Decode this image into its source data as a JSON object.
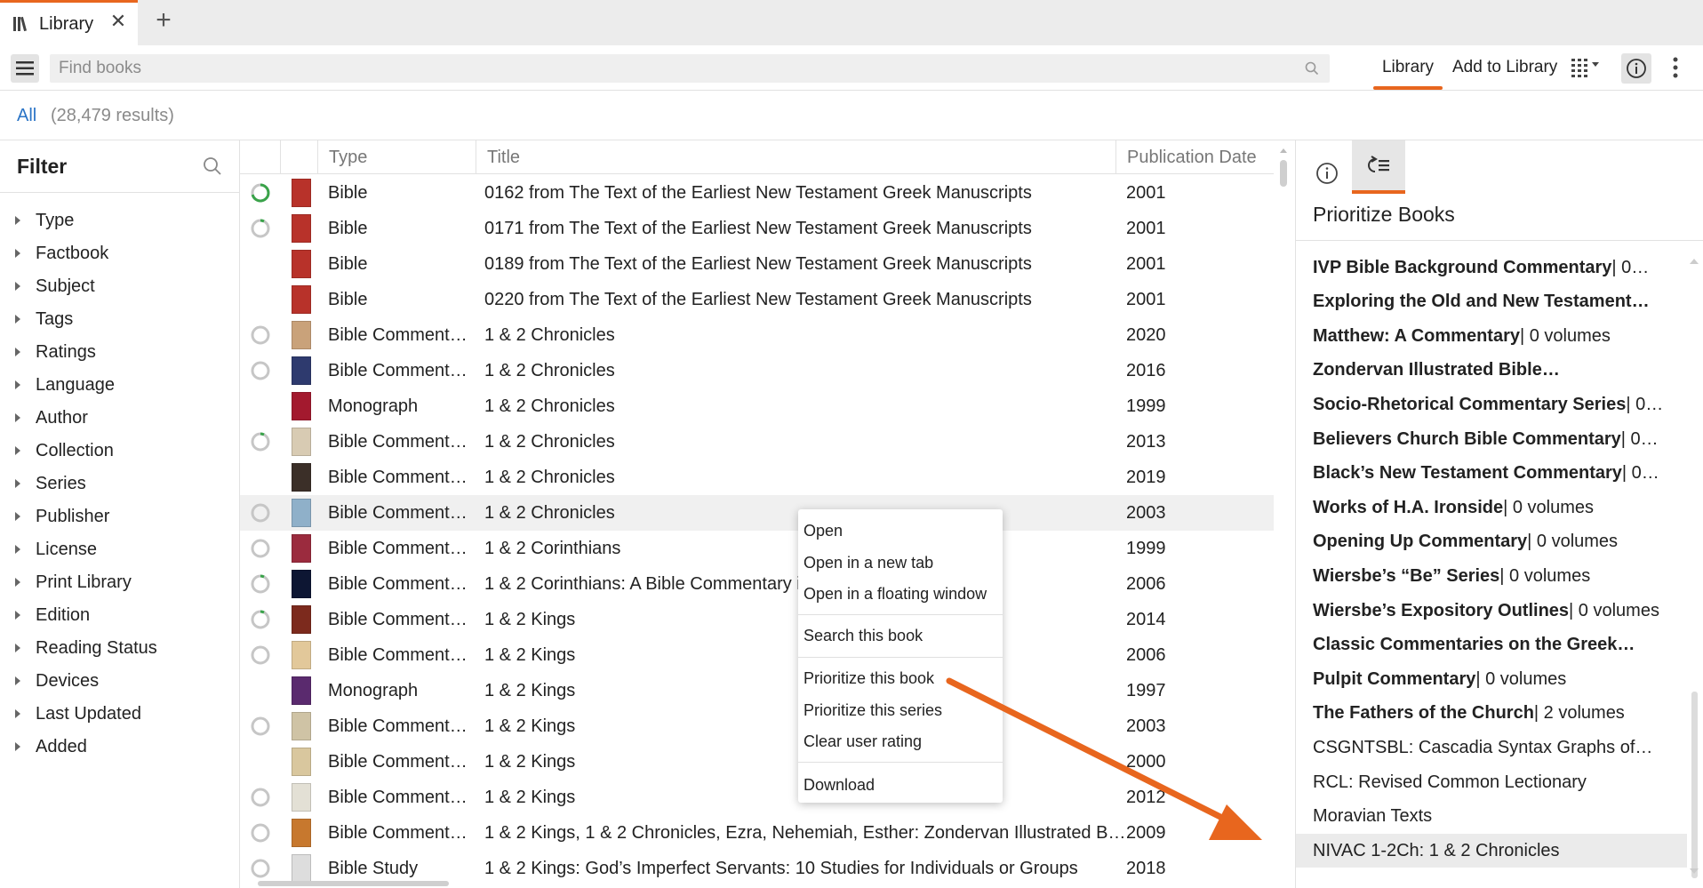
{
  "tab": {
    "label": "Library",
    "close_glyph": "✕",
    "add_glyph": "+"
  },
  "toolbar": {
    "search_placeholder": "Find books",
    "library_label": "Library",
    "add_to_library_label": "Add to Library"
  },
  "results": {
    "filter_label": "All",
    "count_text": "(28,479 results)"
  },
  "filter": {
    "title": "Filter",
    "items": [
      "Type",
      "Factbook",
      "Subject",
      "Tags",
      "Ratings",
      "Language",
      "Author",
      "Collection",
      "Series",
      "Publisher",
      "License",
      "Print Library",
      "Edition",
      "Reading Status",
      "Devices",
      "Last Updated",
      "Added"
    ]
  },
  "table": {
    "headers": {
      "type": "Type",
      "title": "Title",
      "date": "Publication Date"
    },
    "rows": [
      {
        "status": "progress-high",
        "cover": "#b8322a",
        "type": "Bible",
        "title": "0162 from The Text of the Earliest New Testament Greek Manuscripts",
        "date": "2001"
      },
      {
        "status": "progress-low",
        "cover": "#b8322a",
        "type": "Bible",
        "title": "0171 from The Text of the Earliest New Testament Greek Manuscripts",
        "date": "2001"
      },
      {
        "status": "none",
        "cover": "#b8322a",
        "type": "Bible",
        "title": "0189 from The Text of the Earliest New Testament Greek Manuscripts",
        "date": "2001"
      },
      {
        "status": "none",
        "cover": "#b8322a",
        "type": "Bible",
        "title": "0220 from The Text of the Earliest New Testament Greek Manuscripts",
        "date": "2001"
      },
      {
        "status": "empty",
        "cover": "#c9a27a",
        "type": "Bible Comment…",
        "title": "1 & 2 Chronicles",
        "date": "2020"
      },
      {
        "status": "empty",
        "cover": "#2e3a6e",
        "type": "Bible Comment…",
        "title": "1 & 2 Chronicles",
        "date": "2016"
      },
      {
        "status": "none",
        "cover": "#a3192e",
        "type": "Monograph",
        "title": "1 & 2 Chronicles",
        "date": "1999"
      },
      {
        "status": "progress-low",
        "cover": "#d8cbb3",
        "type": "Bible Comment…",
        "title": "1 & 2 Chronicles",
        "date": "2013"
      },
      {
        "status": "none",
        "cover": "#3b2f28",
        "type": "Bible Comment…",
        "title": "1 & 2 Chronicles",
        "date": "2019"
      },
      {
        "status": "empty",
        "cover": "#8fb0c9",
        "type": "Bible Comment…",
        "title": "1 & 2 Chronicles",
        "date": "2003"
      },
      {
        "status": "empty",
        "cover": "#9b2b3e",
        "type": "Bible Comment…",
        "title": "1 & 2 Corinthians",
        "date": "1999"
      },
      {
        "status": "progress-low",
        "cover": "#0d1633",
        "type": "Bible Comment…",
        "title": "1 & 2 Corinthians: A Bible Commentary i",
        "date": "2006"
      },
      {
        "status": "progress-low",
        "cover": "#7c2a1d",
        "type": "Bible Comment…",
        "title": "1 & 2 Kings",
        "date": "2014"
      },
      {
        "status": "empty",
        "cover": "#e2c89a",
        "type": "Bible Comment…",
        "title": "1 & 2 Kings",
        "date": "2006"
      },
      {
        "status": "none",
        "cover": "#5a2a6e",
        "type": "Monograph",
        "title": "1 & 2 Kings",
        "date": "1997"
      },
      {
        "status": "empty",
        "cover": "#cfc3a5",
        "type": "Bible Comment…",
        "title": "1 & 2 Kings",
        "date": "2003"
      },
      {
        "status": "none",
        "cover": "#d9c79e",
        "type": "Bible Comment…",
        "title": "1 & 2 Kings",
        "date": "2000"
      },
      {
        "status": "empty",
        "cover": "#e3e0d5",
        "type": "Bible Comment…",
        "title": "1 & 2 Kings",
        "date": "2012"
      },
      {
        "status": "empty",
        "cover": "#c7782e",
        "type": "Bible Comment…",
        "title": "1 & 2 Kings, 1 & 2 Chronicles, Ezra, Nehemiah, Esther: Zondervan Illustrated B…",
        "date": "2009"
      },
      {
        "status": "empty",
        "cover": "#dddddd",
        "type": "Bible Study",
        "title": "1 & 2 Kings: God’s Imperfect Servants: 10 Studies for Individuals or Groups",
        "date": "2018"
      }
    ]
  },
  "context_menu": {
    "items": [
      "Open",
      "Open in a new tab",
      "Open in a floating window",
      "Search this book",
      "Prioritize this book",
      "Prioritize this series",
      "Clear user rating",
      "Download"
    ]
  },
  "right_panel": {
    "title": "Prioritize Books",
    "items": [
      {
        "name": "IVP Bible Background Commentary",
        "suffix": " | 0…",
        "bold": true
      },
      {
        "name": "Exploring the Old and New Testament…",
        "suffix": "",
        "bold": true
      },
      {
        "name": "Matthew: A Commentary",
        "suffix": " | 0 volumes",
        "bold": true
      },
      {
        "name": "Zondervan Illustrated Bible…",
        "suffix": "",
        "bold": true
      },
      {
        "name": "Socio-Rhetorical Commentary Series",
        "suffix": " | 0…",
        "bold": true
      },
      {
        "name": "Believers Church Bible Commentary",
        "suffix": " | 0…",
        "bold": true
      },
      {
        "name": "Black’s New Testament Commentary",
        "suffix": " | 0…",
        "bold": true
      },
      {
        "name": "Works of H.A. Ironside",
        "suffix": " | 0 volumes",
        "bold": true
      },
      {
        "name": "Opening Up Commentary",
        "suffix": " | 0 volumes",
        "bold": true
      },
      {
        "name": "Wiersbe’s “Be” Series",
        "suffix": " | 0 volumes",
        "bold": true
      },
      {
        "name": "Wiersbe’s Expository Outlines",
        "suffix": " | 0 volumes",
        "bold": true
      },
      {
        "name": "Classic Commentaries on the Greek…",
        "suffix": "",
        "bold": true
      },
      {
        "name": "Pulpit Commentary",
        "suffix": " | 0 volumes",
        "bold": true
      },
      {
        "name": "The Fathers of the Church",
        "suffix": " | 2 volumes",
        "bold": true
      },
      {
        "name": "CSGNTSBL: Cascadia Syntax Graphs of…",
        "suffix": "",
        "bold": false
      },
      {
        "name": "RCL: Revised Common Lectionary",
        "suffix": "",
        "bold": false
      },
      {
        "name": "Moravian Texts",
        "suffix": "",
        "bold": false
      },
      {
        "name": "NIVAC 1-2Ch: 1 & 2 Chronicles",
        "suffix": "",
        "bold": false
      }
    ]
  },
  "colors": {
    "accent": "#e8661e",
    "link": "#2a74c6",
    "progress": "#3aa34a"
  }
}
